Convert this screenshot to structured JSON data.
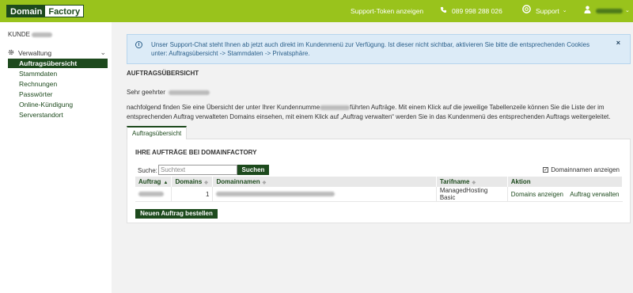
{
  "header": {
    "logo_part1": "Domain",
    "logo_part2": "Factory",
    "support_token": "Support-Token anzeigen",
    "phone": "089 998 288 026",
    "support_menu": "Support",
    "user_icon": "user-icon"
  },
  "sidebar": {
    "kunde_label": "KUNDE",
    "section_label": "Verwaltung",
    "active_item": "Auftragsübersicht",
    "items": [
      {
        "label": "Stammdaten"
      },
      {
        "label": "Rechnungen"
      },
      {
        "label": "Passwörter"
      },
      {
        "label": "Online-Kündigung"
      },
      {
        "label": "Serverstandort"
      }
    ]
  },
  "info_box": {
    "text": "Unser Support-Chat steht Ihnen ab jetzt auch direkt im Kundenmenü zur Verfügung. Ist dieser nicht sichtbar, aktivieren Sie bitte die entsprechenden Cookies unter: Auftragsübersicht -> Stammdaten -> Privatsphäre.",
    "close": "×"
  },
  "main": {
    "section_title": "AUFTRAGSÜBERSICHT",
    "greeting": "Sehr geehrter",
    "para_part1": "nachfolgend finden Sie eine Übersicht der unter Ihrer Kundennumme",
    "para_part2": "führten Aufträge. Mit einem Klick auf die jeweilige Tabellenzeile können Sie die Liste der im entsprechenden Auftrag verwalteten Domains einsehen, mit einem Klick auf „Auftrag verwalten“ werden Sie in das Kundenmenü des entsprechenden Auftrags weitergeleitet.",
    "tab_label": "Auftragsübersicht",
    "panel_title": "IHRE AUFTRÄGE BEI DOMAINFACTORY",
    "search_label": "Suche:",
    "search_placeholder": "Suchtext",
    "search_button": "Suchen",
    "checkbox_label": "Domainnamen anzeigen",
    "checkbox_checked": true,
    "new_order_button": "Neuen Auftrag bestellen"
  },
  "table": {
    "columns": [
      "Auftrag",
      "Domains",
      "Domainnamen",
      "Tarifname",
      "Aktion"
    ],
    "rows": [
      {
        "domains": "1",
        "tarif": "ManagedHosting Basic",
        "action1": "Domains anzeigen",
        "action2": "Auftrag verwalten"
      }
    ]
  },
  "colors": {
    "brand_green": "#99c31c",
    "dark_green": "#1d4a1d",
    "info_bg": "#dcebf7"
  }
}
